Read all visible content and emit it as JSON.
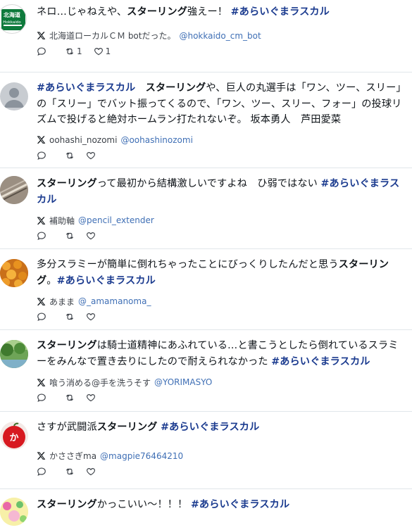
{
  "posts": [
    {
      "avatar": "hokkaido-sign-avatar",
      "avatar_text": [
        "北海道",
        "Hokkaido"
      ],
      "segments": [
        {
          "t": "ネロ…じゃねえや、",
          "s": "n"
        },
        {
          "t": "スターリング",
          "s": "b"
        },
        {
          "t": "強えー！ ",
          "s": "n"
        },
        {
          "t": "#あらいぐまラスカル",
          "s": "h"
        }
      ],
      "name": "北海道ローカルＣＭ botだった。",
      "handle": "@hokkaido_cm_bot",
      "retweets": "1",
      "likes": "1"
    },
    {
      "avatar": "default-user-avatar",
      "segments": [
        {
          "t": "#あらいぐまラスカル",
          "s": "h"
        },
        {
          "t": "　",
          "s": "n"
        },
        {
          "t": "スターリング",
          "s": "b"
        },
        {
          "t": "や、巨人の丸選手は「ワン、ツー、スリー」の「スリー」でバット振ってくるので、「ワン、ツー、スリー、フォー」の投球リズムで投げると絶対ホームラン打たれないぞ。 坂本勇人　芦田愛菜",
          "s": "n"
        }
      ],
      "name": "oohashi_nozomi",
      "handle": "@oohashinozomi",
      "retweets": "",
      "likes": ""
    },
    {
      "avatar": "pencil-photo-avatar",
      "segments": [
        {
          "t": "スターリング",
          "s": "b"
        },
        {
          "t": "って最初から結構激しいですよね　ひ弱ではない ",
          "s": "n"
        },
        {
          "t": "#あらいぐまラスカル",
          "s": "h"
        }
      ],
      "name": "補助軸",
      "handle": "@pencil_extender",
      "retweets": "",
      "likes": ""
    },
    {
      "avatar": "orange-flowers-avatar",
      "segments": [
        {
          "t": "多分スラミーが簡単に倒れちゃったことにびっくりしたんだと思う",
          "s": "n"
        },
        {
          "t": "スターリング",
          "s": "b"
        },
        {
          "t": "。",
          "s": "n"
        },
        {
          "t": "#あらいぐまラスカル",
          "s": "h"
        }
      ],
      "name": "あまま",
      "handle": "@_amamanoma_",
      "retweets": "",
      "likes": ""
    },
    {
      "avatar": "green-landscape-avatar",
      "segments": [
        {
          "t": "スターリング",
          "s": "b"
        },
        {
          "t": "は騎士道精神にあふれている…と書こうとしたら倒れているスラミーをみんなで置き去りにしたので耐えられなかった ",
          "s": "n"
        },
        {
          "t": "#あらいぐまラスカル",
          "s": "h"
        }
      ],
      "name": "喰う消める@手を洗うそす",
      "handle": "@YORIMASYO",
      "retweets": "",
      "likes": ""
    },
    {
      "avatar": "red-apple-avatar",
      "avatar_text": [
        "か"
      ],
      "segments": [
        {
          "t": "さすが武闘派",
          "s": "n"
        },
        {
          "t": "スターリング",
          "s": "b"
        },
        {
          "t": " ",
          "s": "n"
        },
        {
          "t": "#あらいぐまラスカル",
          "s": "h"
        }
      ],
      "name": "かささぎma",
      "handle": "@magpie76464210",
      "retweets": "",
      "likes": ""
    },
    {
      "avatar": "colorful-avatar",
      "segments": [
        {
          "t": "スターリング",
          "s": "b"
        },
        {
          "t": "かっこいい〜！！！ ",
          "s": "n"
        },
        {
          "t": "#あらいぐまラスカル",
          "s": "h"
        }
      ],
      "name": "",
      "handle": "",
      "retweets": "",
      "likes": ""
    }
  ],
  "colors": {
    "hashtag": "#1b3b8f",
    "handle": "#3f6fb5",
    "divider": "#e1e6ea",
    "hokkaido_sign": "#0e7a3c"
  },
  "icons": {
    "platform": "x-logo-icon",
    "reply": "reply-icon",
    "retweet": "retweet-icon",
    "like": "heart-icon"
  }
}
